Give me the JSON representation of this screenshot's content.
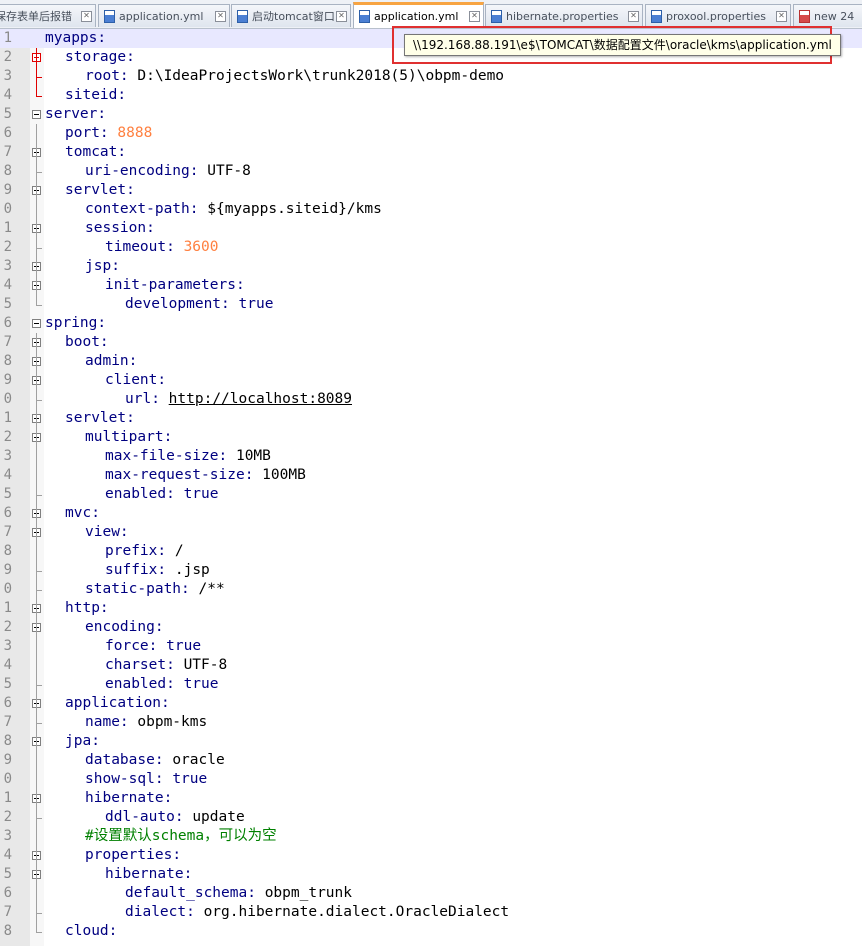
{
  "tabs": [
    {
      "label": "保存表单后报错",
      "icon": "file-icon",
      "active": false,
      "modified": false
    },
    {
      "label": "application.yml",
      "icon": "file-icon",
      "active": false,
      "modified": false
    },
    {
      "label": "启动tomcat窗口",
      "icon": "file-icon",
      "active": false,
      "modified": false
    },
    {
      "label": "application.yml",
      "icon": "file-icon",
      "active": true,
      "modified": false
    },
    {
      "label": "hibernate.properties",
      "icon": "file-icon",
      "active": false,
      "modified": false
    },
    {
      "label": "proxool.properties",
      "icon": "file-icon",
      "active": false,
      "modified": false
    },
    {
      "label": "new 24",
      "icon": "file-icon",
      "active": false,
      "modified": true
    }
  ],
  "tooltip": {
    "path": "\\\\192.168.88.191\\e$\\TOMCAT\\数据配置文件\\oracle\\kms\\application.yml"
  },
  "colors": {
    "keyword": "#000080",
    "number": "#ff8040",
    "comment": "#008000",
    "current_line": "#e8e8ff",
    "fold_active": "#e00000",
    "tooltip_border": "#e03030"
  },
  "lines": [
    {
      "num": "1",
      "indent": 0,
      "key": "myapps",
      "sep": ":",
      "value": "",
      "vtype": ""
    },
    {
      "num": "2",
      "indent": 1,
      "key": "storage",
      "sep": ":",
      "value": "",
      "vtype": ""
    },
    {
      "num": "3",
      "indent": 2,
      "key": "root",
      "sep": ": ",
      "value": "D:\\IdeaProjectsWork\\trunk2018(5)\\obpm-demo",
      "vtype": "plain"
    },
    {
      "num": "4",
      "indent": 1,
      "key": "siteid",
      "sep": ":",
      "value": "",
      "vtype": ""
    },
    {
      "num": "5",
      "indent": 0,
      "key": "server",
      "sep": ":",
      "value": "",
      "vtype": ""
    },
    {
      "num": "6",
      "indent": 1,
      "key": "port",
      "sep": ": ",
      "value": "8888",
      "vtype": "num"
    },
    {
      "num": "7",
      "indent": 1,
      "key": "tomcat",
      "sep": ":",
      "value": "",
      "vtype": ""
    },
    {
      "num": "8",
      "indent": 2,
      "key": "uri-encoding",
      "sep": ": ",
      "value": "UTF-8",
      "vtype": "plain"
    },
    {
      "num": "9",
      "indent": 1,
      "key": "servlet",
      "sep": ":",
      "value": "",
      "vtype": ""
    },
    {
      "num": "0",
      "indent": 2,
      "key": "context-path",
      "sep": ": ",
      "value": "${myapps.siteid}/kms",
      "vtype": "plain"
    },
    {
      "num": "1",
      "indent": 2,
      "key": "session",
      "sep": ":",
      "value": "",
      "vtype": ""
    },
    {
      "num": "2",
      "indent": 3,
      "key": "timeout",
      "sep": ": ",
      "value": "3600",
      "vtype": "num"
    },
    {
      "num": "3",
      "indent": 2,
      "key": "jsp",
      "sep": ":",
      "value": "",
      "vtype": ""
    },
    {
      "num": "4",
      "indent": 3,
      "key": "init-parameters",
      "sep": ":",
      "value": "",
      "vtype": ""
    },
    {
      "num": "5",
      "indent": 4,
      "key": "development",
      "sep": ": ",
      "value": "true",
      "vtype": "bool"
    },
    {
      "num": "6",
      "indent": 0,
      "key": "spring",
      "sep": ":",
      "value": "",
      "vtype": ""
    },
    {
      "num": "7",
      "indent": 1,
      "key": "boot",
      "sep": ":",
      "value": "",
      "vtype": ""
    },
    {
      "num": "8",
      "indent": 2,
      "key": "admin",
      "sep": ":",
      "value": "",
      "vtype": ""
    },
    {
      "num": "9",
      "indent": 3,
      "key": "client",
      "sep": ":",
      "value": "",
      "vtype": ""
    },
    {
      "num": "0",
      "indent": 4,
      "key": "url",
      "sep": ": ",
      "value": "http://localhost:8089",
      "vtype": "url"
    },
    {
      "num": "1",
      "indent": 1,
      "key": "servlet",
      "sep": ":",
      "value": "",
      "vtype": ""
    },
    {
      "num": "2",
      "indent": 2,
      "key": "multipart",
      "sep": ":",
      "value": "",
      "vtype": ""
    },
    {
      "num": "3",
      "indent": 3,
      "key": "max-file-size",
      "sep": ": ",
      "value": "10MB",
      "vtype": "plain"
    },
    {
      "num": "4",
      "indent": 3,
      "key": "max-request-size",
      "sep": ": ",
      "value": "100MB",
      "vtype": "plain"
    },
    {
      "num": "5",
      "indent": 3,
      "key": "enabled",
      "sep": ": ",
      "value": "true",
      "vtype": "bool"
    },
    {
      "num": "6",
      "indent": 1,
      "key": "mvc",
      "sep": ":",
      "value": "",
      "vtype": ""
    },
    {
      "num": "7",
      "indent": 2,
      "key": "view",
      "sep": ":",
      "value": "",
      "vtype": ""
    },
    {
      "num": "8",
      "indent": 3,
      "key": "prefix",
      "sep": ": ",
      "value": "/",
      "vtype": "plain"
    },
    {
      "num": "9",
      "indent": 3,
      "key": "suffix",
      "sep": ": ",
      "value": ".jsp",
      "vtype": "plain"
    },
    {
      "num": "0",
      "indent": 2,
      "key": "static-path",
      "sep": ": ",
      "value": "/**",
      "vtype": "plain"
    },
    {
      "num": "1",
      "indent": 1,
      "key": "http",
      "sep": ":",
      "value": "",
      "vtype": ""
    },
    {
      "num": "2",
      "indent": 2,
      "key": "encoding",
      "sep": ":",
      "value": "",
      "vtype": ""
    },
    {
      "num": "3",
      "indent": 3,
      "key": "force",
      "sep": ": ",
      "value": "true",
      "vtype": "bool"
    },
    {
      "num": "4",
      "indent": 3,
      "key": "charset",
      "sep": ": ",
      "value": "UTF-8",
      "vtype": "plain"
    },
    {
      "num": "5",
      "indent": 3,
      "key": "enabled",
      "sep": ": ",
      "value": "true",
      "vtype": "bool"
    },
    {
      "num": "6",
      "indent": 1,
      "key": "application",
      "sep": ":",
      "value": "",
      "vtype": ""
    },
    {
      "num": "7",
      "indent": 2,
      "key": "name",
      "sep": ": ",
      "value": "obpm-kms",
      "vtype": "plain"
    },
    {
      "num": "8",
      "indent": 1,
      "key": "jpa",
      "sep": ":",
      "value": "",
      "vtype": ""
    },
    {
      "num": "9",
      "indent": 2,
      "key": "database",
      "sep": ": ",
      "value": "oracle",
      "vtype": "plain"
    },
    {
      "num": "0",
      "indent": 2,
      "key": "show-sql",
      "sep": ": ",
      "value": "true",
      "vtype": "bool"
    },
    {
      "num": "1",
      "indent": 2,
      "key": "hibernate",
      "sep": ":",
      "value": "",
      "vtype": ""
    },
    {
      "num": "2",
      "indent": 3,
      "key": "ddl-auto",
      "sep": ": ",
      "value": "update",
      "vtype": "plain"
    },
    {
      "num": "3",
      "indent": 2,
      "key": "",
      "sep": "",
      "value": "#设置默认schema，可以为空",
      "vtype": "comment"
    },
    {
      "num": "4",
      "indent": 2,
      "key": "properties",
      "sep": ":",
      "value": "",
      "vtype": ""
    },
    {
      "num": "5",
      "indent": 3,
      "key": "hibernate",
      "sep": ":",
      "value": "",
      "vtype": ""
    },
    {
      "num": "6",
      "indent": 4,
      "key": "default_schema",
      "sep": ": ",
      "value": "obpm_trunk",
      "vtype": "plain"
    },
    {
      "num": "7",
      "indent": 4,
      "key": "dialect",
      "sep": ": ",
      "value": "org.hibernate.dialect.OracleDialect",
      "vtype": "plain"
    },
    {
      "num": "8",
      "indent": 1,
      "key": "cloud",
      "sep": ":",
      "value": "",
      "vtype": ""
    }
  ]
}
